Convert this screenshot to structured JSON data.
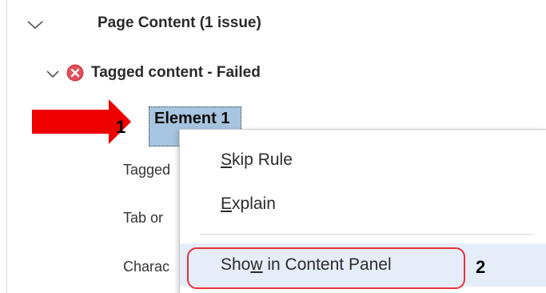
{
  "tree": {
    "section": {
      "label": "Page Content (1 issue)"
    },
    "rule": {
      "label": "Tagged content - Failed",
      "status_color": "#e0505a"
    },
    "selected_element": {
      "label": "Element 1"
    },
    "children": [
      {
        "label": "Tagged"
      },
      {
        "label": "Tab or"
      },
      {
        "label": "Charac"
      }
    ]
  },
  "context_menu": {
    "items": [
      {
        "label_pre": "",
        "mnemonic": "S",
        "label_post": "kip Rule"
      },
      {
        "label_pre": "",
        "mnemonic": "E",
        "label_post": "xplain"
      },
      {
        "label_pre": "Sho",
        "mnemonic": "w",
        "label_post": " in Content Panel"
      }
    ],
    "hover_color": "#e5eef8"
  },
  "annotations": {
    "step1": "1",
    "step2": "2",
    "arrow_color": "#ee0000",
    "callout_color": "#e5323a"
  }
}
